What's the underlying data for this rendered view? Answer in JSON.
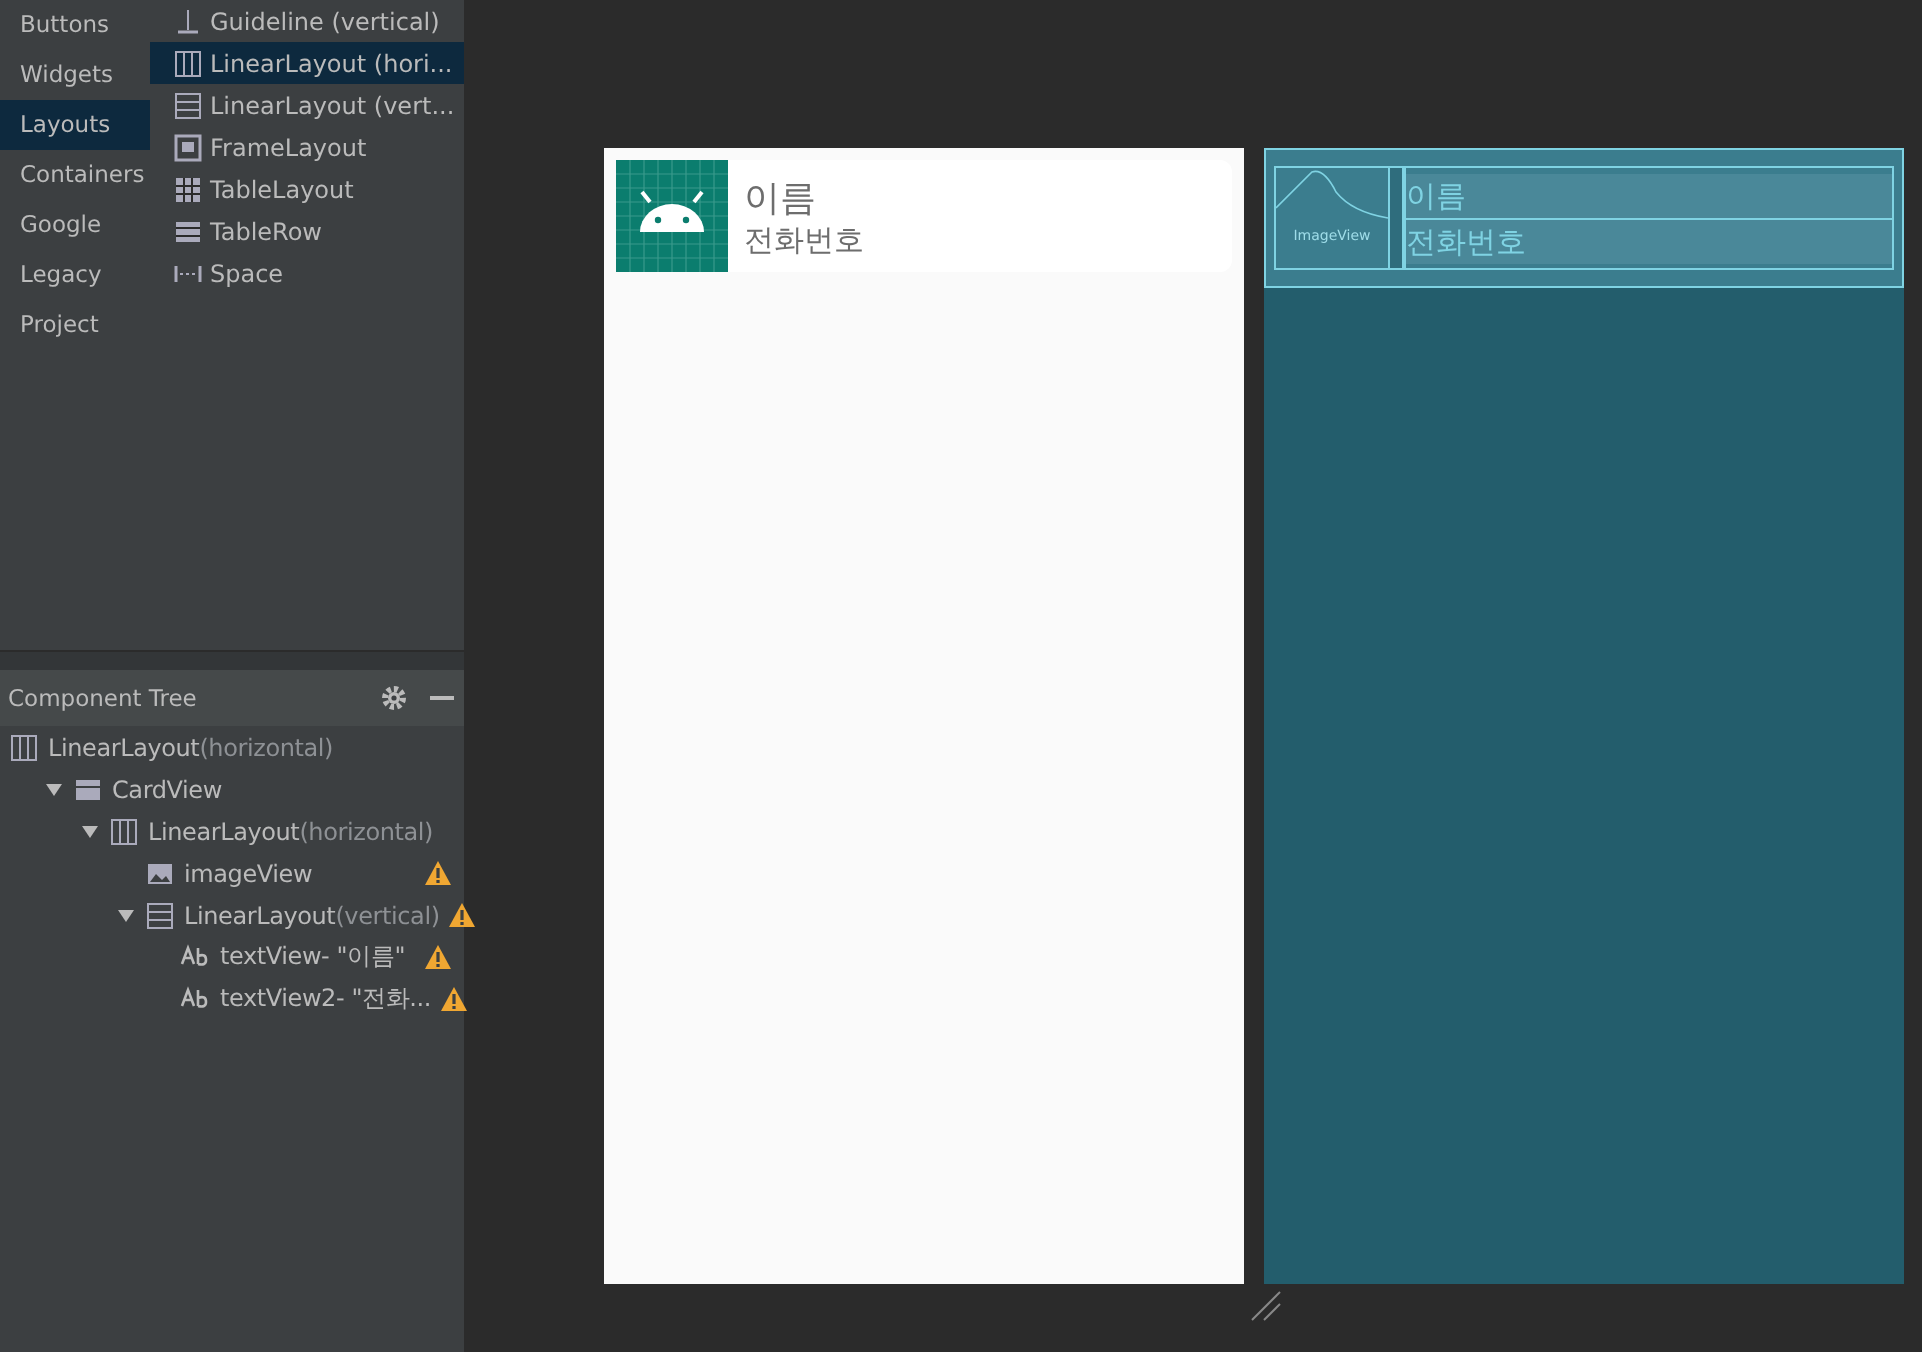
{
  "palette": {
    "categories": [
      {
        "label": "Buttons",
        "selected": false
      },
      {
        "label": "Widgets",
        "selected": false
      },
      {
        "label": "Layouts",
        "selected": true
      },
      {
        "label": "Containers",
        "selected": false
      },
      {
        "label": "Google",
        "selected": false
      },
      {
        "label": "Legacy",
        "selected": false
      },
      {
        "label": "Project",
        "selected": false
      }
    ],
    "items": [
      {
        "label": "Guideline (vertical)",
        "kind": "guideline",
        "selected": false
      },
      {
        "label": "LinearLayout (hori...",
        "kind": "linear-h",
        "selected": true
      },
      {
        "label": "LinearLayout (vert...",
        "kind": "linear-v",
        "selected": false
      },
      {
        "label": "FrameLayout",
        "kind": "frame",
        "selected": false
      },
      {
        "label": "TableLayout",
        "kind": "table",
        "selected": false
      },
      {
        "label": "TableRow",
        "kind": "tablerow",
        "selected": false
      },
      {
        "label": "Space",
        "kind": "space",
        "selected": false
      }
    ]
  },
  "component_tree": {
    "title": "Component Tree",
    "nodes": [
      {
        "label": "LinearLayout",
        "hint": "(horizontal)",
        "kind": "linear-h",
        "warning": false,
        "children": [
          {
            "label": "CardView",
            "kind": "card",
            "expanded": true,
            "warning": false,
            "children": [
              {
                "label": "LinearLayout",
                "hint": "(horizontal)",
                "kind": "linear-h",
                "expanded": true,
                "warning": false,
                "children": [
                  {
                    "label": "imageView",
                    "kind": "image",
                    "warning": true
                  },
                  {
                    "label": "LinearLayout",
                    "hint": "(vertical)",
                    "kind": "linear-v",
                    "expanded": true,
                    "warning": true,
                    "children": [
                      {
                        "label": "textView- \"이름\"",
                        "kind": "text",
                        "warning": true
                      },
                      {
                        "label": "textView2- \"전화...",
                        "kind": "text",
                        "warning": true
                      }
                    ]
                  }
                ]
              }
            ]
          }
        ]
      }
    ]
  },
  "design": {
    "name": "이름",
    "phone": "전화번호"
  },
  "blueprint": {
    "image_label": "ImageView",
    "name": "이름",
    "phone": "전화번호"
  }
}
